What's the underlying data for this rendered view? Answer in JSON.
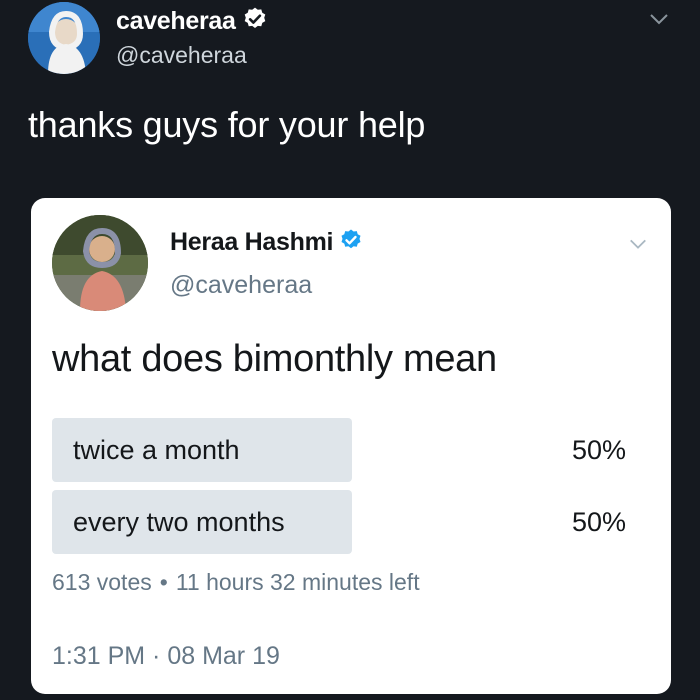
{
  "outer_tweet": {
    "display_name": "caveheraa",
    "handle": "@caveheraa",
    "text": "thanks guys for your help"
  },
  "quoted_tweet": {
    "display_name": "Heraa Hashmi",
    "handle": "@caveheraa",
    "text": "what does bimonthly mean",
    "poll": {
      "options": [
        {
          "label": "twice a month",
          "percent": "50%",
          "fraction": 0.5
        },
        {
          "label": "every two months",
          "percent": "50%",
          "fraction": 0.5
        }
      ],
      "votes": "613 votes",
      "time_left": "11 hours 32 minutes left"
    },
    "timestamp": "1:31 PM · 08 Mar 19"
  },
  "icons": {
    "verified": "verified-badge-icon",
    "chevron": "chevron-down-icon"
  },
  "colors": {
    "background": "#15191f",
    "card": "#ffffff",
    "verified_blue": "#1da1f2",
    "poll_bar": "#dfe5ea",
    "secondary_text": "#657786"
  }
}
